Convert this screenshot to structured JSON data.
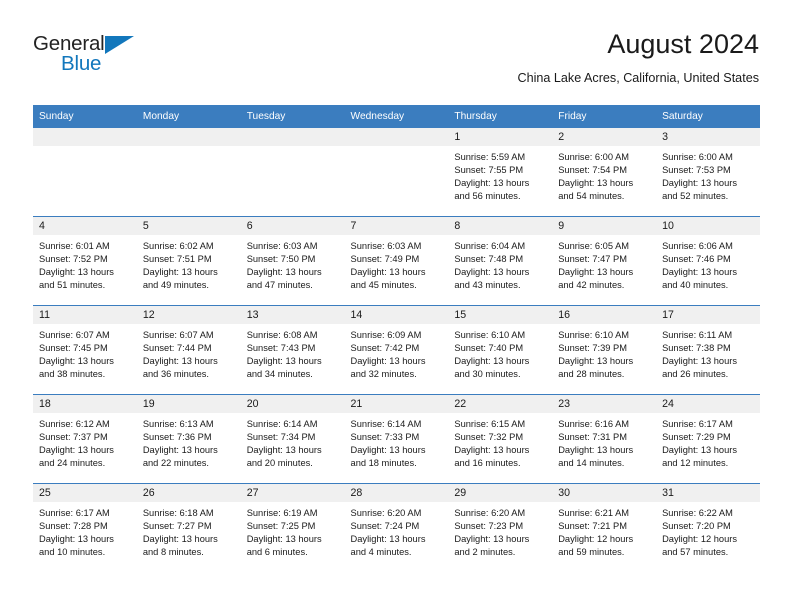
{
  "brand": {
    "name_top": "General",
    "name_bottom": "Blue",
    "accent_color": "#1277bc",
    "triangle_icon": "triangle-icon"
  },
  "header": {
    "title": "August 2024",
    "subtitle": "China Lake Acres, California, United States"
  },
  "calendar": {
    "header_bg": "#3b7dbf",
    "header_text_color": "#ffffff",
    "daynum_bg": "#f0f0f0",
    "weekday_headers": [
      "Sunday",
      "Monday",
      "Tuesday",
      "Wednesday",
      "Thursday",
      "Friday",
      "Saturday"
    ],
    "weeks": [
      [
        {
          "day": "",
          "sunrise": "",
          "sunset": "",
          "daylight_line1": "",
          "daylight_line2": ""
        },
        {
          "day": "",
          "sunrise": "",
          "sunset": "",
          "daylight_line1": "",
          "daylight_line2": ""
        },
        {
          "day": "",
          "sunrise": "",
          "sunset": "",
          "daylight_line1": "",
          "daylight_line2": ""
        },
        {
          "day": "",
          "sunrise": "",
          "sunset": "",
          "daylight_line1": "",
          "daylight_line2": ""
        },
        {
          "day": "1",
          "sunrise": "Sunrise: 5:59 AM",
          "sunset": "Sunset: 7:55 PM",
          "daylight_line1": "Daylight: 13 hours",
          "daylight_line2": "and 56 minutes."
        },
        {
          "day": "2",
          "sunrise": "Sunrise: 6:00 AM",
          "sunset": "Sunset: 7:54 PM",
          "daylight_line1": "Daylight: 13 hours",
          "daylight_line2": "and 54 minutes."
        },
        {
          "day": "3",
          "sunrise": "Sunrise: 6:00 AM",
          "sunset": "Sunset: 7:53 PM",
          "daylight_line1": "Daylight: 13 hours",
          "daylight_line2": "and 52 minutes."
        }
      ],
      [
        {
          "day": "4",
          "sunrise": "Sunrise: 6:01 AM",
          "sunset": "Sunset: 7:52 PM",
          "daylight_line1": "Daylight: 13 hours",
          "daylight_line2": "and 51 minutes."
        },
        {
          "day": "5",
          "sunrise": "Sunrise: 6:02 AM",
          "sunset": "Sunset: 7:51 PM",
          "daylight_line1": "Daylight: 13 hours",
          "daylight_line2": "and 49 minutes."
        },
        {
          "day": "6",
          "sunrise": "Sunrise: 6:03 AM",
          "sunset": "Sunset: 7:50 PM",
          "daylight_line1": "Daylight: 13 hours",
          "daylight_line2": "and 47 minutes."
        },
        {
          "day": "7",
          "sunrise": "Sunrise: 6:03 AM",
          "sunset": "Sunset: 7:49 PM",
          "daylight_line1": "Daylight: 13 hours",
          "daylight_line2": "and 45 minutes."
        },
        {
          "day": "8",
          "sunrise": "Sunrise: 6:04 AM",
          "sunset": "Sunset: 7:48 PM",
          "daylight_line1": "Daylight: 13 hours",
          "daylight_line2": "and 43 minutes."
        },
        {
          "day": "9",
          "sunrise": "Sunrise: 6:05 AM",
          "sunset": "Sunset: 7:47 PM",
          "daylight_line1": "Daylight: 13 hours",
          "daylight_line2": "and 42 minutes."
        },
        {
          "day": "10",
          "sunrise": "Sunrise: 6:06 AM",
          "sunset": "Sunset: 7:46 PM",
          "daylight_line1": "Daylight: 13 hours",
          "daylight_line2": "and 40 minutes."
        }
      ],
      [
        {
          "day": "11",
          "sunrise": "Sunrise: 6:07 AM",
          "sunset": "Sunset: 7:45 PM",
          "daylight_line1": "Daylight: 13 hours",
          "daylight_line2": "and 38 minutes."
        },
        {
          "day": "12",
          "sunrise": "Sunrise: 6:07 AM",
          "sunset": "Sunset: 7:44 PM",
          "daylight_line1": "Daylight: 13 hours",
          "daylight_line2": "and 36 minutes."
        },
        {
          "day": "13",
          "sunrise": "Sunrise: 6:08 AM",
          "sunset": "Sunset: 7:43 PM",
          "daylight_line1": "Daylight: 13 hours",
          "daylight_line2": "and 34 minutes."
        },
        {
          "day": "14",
          "sunrise": "Sunrise: 6:09 AM",
          "sunset": "Sunset: 7:42 PM",
          "daylight_line1": "Daylight: 13 hours",
          "daylight_line2": "and 32 minutes."
        },
        {
          "day": "15",
          "sunrise": "Sunrise: 6:10 AM",
          "sunset": "Sunset: 7:40 PM",
          "daylight_line1": "Daylight: 13 hours",
          "daylight_line2": "and 30 minutes."
        },
        {
          "day": "16",
          "sunrise": "Sunrise: 6:10 AM",
          "sunset": "Sunset: 7:39 PM",
          "daylight_line1": "Daylight: 13 hours",
          "daylight_line2": "and 28 minutes."
        },
        {
          "day": "17",
          "sunrise": "Sunrise: 6:11 AM",
          "sunset": "Sunset: 7:38 PM",
          "daylight_line1": "Daylight: 13 hours",
          "daylight_line2": "and 26 minutes."
        }
      ],
      [
        {
          "day": "18",
          "sunrise": "Sunrise: 6:12 AM",
          "sunset": "Sunset: 7:37 PM",
          "daylight_line1": "Daylight: 13 hours",
          "daylight_line2": "and 24 minutes."
        },
        {
          "day": "19",
          "sunrise": "Sunrise: 6:13 AM",
          "sunset": "Sunset: 7:36 PM",
          "daylight_line1": "Daylight: 13 hours",
          "daylight_line2": "and 22 minutes."
        },
        {
          "day": "20",
          "sunrise": "Sunrise: 6:14 AM",
          "sunset": "Sunset: 7:34 PM",
          "daylight_line1": "Daylight: 13 hours",
          "daylight_line2": "and 20 minutes."
        },
        {
          "day": "21",
          "sunrise": "Sunrise: 6:14 AM",
          "sunset": "Sunset: 7:33 PM",
          "daylight_line1": "Daylight: 13 hours",
          "daylight_line2": "and 18 minutes."
        },
        {
          "day": "22",
          "sunrise": "Sunrise: 6:15 AM",
          "sunset": "Sunset: 7:32 PM",
          "daylight_line1": "Daylight: 13 hours",
          "daylight_line2": "and 16 minutes."
        },
        {
          "day": "23",
          "sunrise": "Sunrise: 6:16 AM",
          "sunset": "Sunset: 7:31 PM",
          "daylight_line1": "Daylight: 13 hours",
          "daylight_line2": "and 14 minutes."
        },
        {
          "day": "24",
          "sunrise": "Sunrise: 6:17 AM",
          "sunset": "Sunset: 7:29 PM",
          "daylight_line1": "Daylight: 13 hours",
          "daylight_line2": "and 12 minutes."
        }
      ],
      [
        {
          "day": "25",
          "sunrise": "Sunrise: 6:17 AM",
          "sunset": "Sunset: 7:28 PM",
          "daylight_line1": "Daylight: 13 hours",
          "daylight_line2": "and 10 minutes."
        },
        {
          "day": "26",
          "sunrise": "Sunrise: 6:18 AM",
          "sunset": "Sunset: 7:27 PM",
          "daylight_line1": "Daylight: 13 hours",
          "daylight_line2": "and 8 minutes."
        },
        {
          "day": "27",
          "sunrise": "Sunrise: 6:19 AM",
          "sunset": "Sunset: 7:25 PM",
          "daylight_line1": "Daylight: 13 hours",
          "daylight_line2": "and 6 minutes."
        },
        {
          "day": "28",
          "sunrise": "Sunrise: 6:20 AM",
          "sunset": "Sunset: 7:24 PM",
          "daylight_line1": "Daylight: 13 hours",
          "daylight_line2": "and 4 minutes."
        },
        {
          "day": "29",
          "sunrise": "Sunrise: 6:20 AM",
          "sunset": "Sunset: 7:23 PM",
          "daylight_line1": "Daylight: 13 hours",
          "daylight_line2": "and 2 minutes."
        },
        {
          "day": "30",
          "sunrise": "Sunrise: 6:21 AM",
          "sunset": "Sunset: 7:21 PM",
          "daylight_line1": "Daylight: 12 hours",
          "daylight_line2": "and 59 minutes."
        },
        {
          "day": "31",
          "sunrise": "Sunrise: 6:22 AM",
          "sunset": "Sunset: 7:20 PM",
          "daylight_line1": "Daylight: 12 hours",
          "daylight_line2": "and 57 minutes."
        }
      ]
    ]
  }
}
